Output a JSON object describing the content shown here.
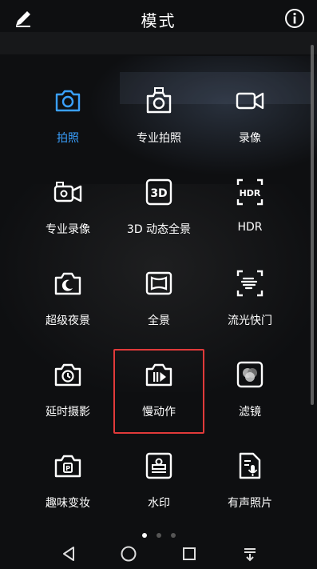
{
  "header": {
    "title": "模式",
    "edit_icon": "pencil-icon",
    "info_icon": "info-icon"
  },
  "modes": [
    {
      "label": "拍照",
      "icon": "camera-icon",
      "active": true
    },
    {
      "label": "专业拍照",
      "icon": "pro-camera-icon"
    },
    {
      "label": "录像",
      "icon": "video-icon"
    },
    {
      "label": "专业录像",
      "icon": "pro-video-icon"
    },
    {
      "label": "3D 动态全景",
      "icon": "3d-panorama-icon"
    },
    {
      "label": "HDR",
      "icon": "hdr-icon"
    },
    {
      "label": "超级夜景",
      "icon": "night-icon"
    },
    {
      "label": "全景",
      "icon": "panorama-icon"
    },
    {
      "label": "流光快门",
      "icon": "light-painting-icon"
    },
    {
      "label": "延时摄影",
      "icon": "timelapse-icon"
    },
    {
      "label": "慢动作",
      "icon": "slow-motion-icon",
      "selected": true
    },
    {
      "label": "滤镜",
      "icon": "filter-icon"
    },
    {
      "label": "趣味变妆",
      "icon": "ar-lens-icon"
    },
    {
      "label": "水印",
      "icon": "watermark-icon"
    },
    {
      "label": "有声照片",
      "icon": "audio-note-icon"
    }
  ],
  "pagination": {
    "pages": 3,
    "current": 1
  },
  "colors": {
    "accent": "#3aa0ff",
    "highlight_border": "#e03a3a"
  },
  "navbar": {
    "back_icon": "back-triangle-icon",
    "home_icon": "home-circle-icon",
    "recents_icon": "recents-square-icon",
    "notifications_icon": "pull-down-icon"
  }
}
